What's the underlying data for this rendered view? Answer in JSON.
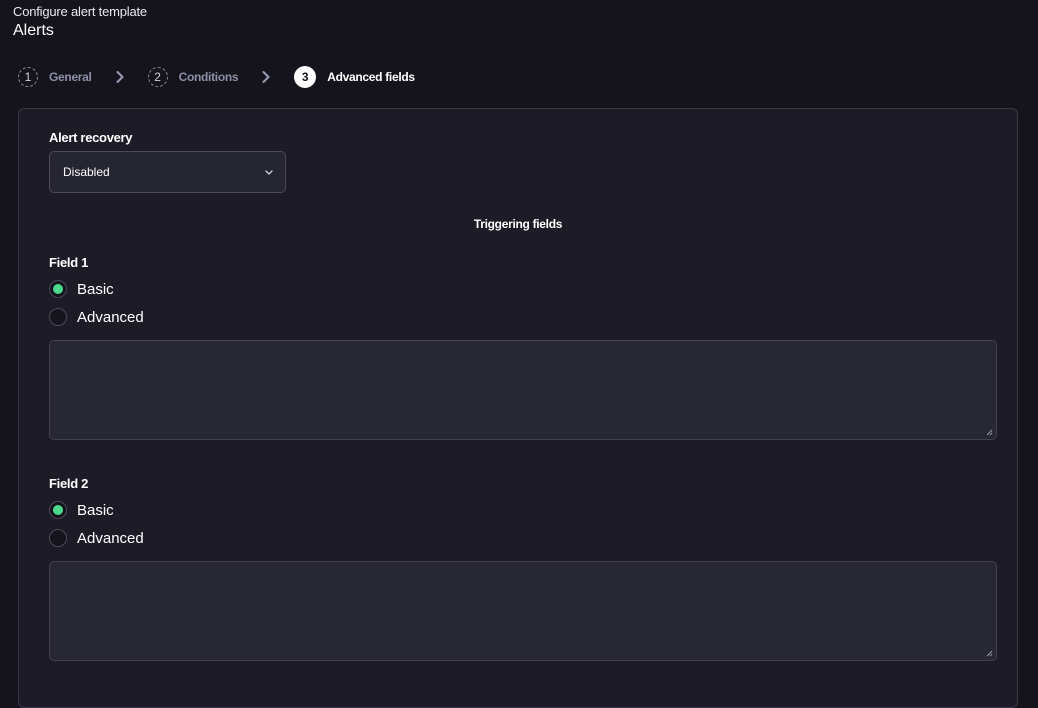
{
  "header": {
    "subtitle": "Configure alert template",
    "title": "Alerts"
  },
  "stepper": {
    "steps": [
      {
        "num": "1",
        "label": "General",
        "active": false
      },
      {
        "num": "2",
        "label": "Conditions",
        "active": false
      },
      {
        "num": "3",
        "label": "Advanced fields",
        "active": true
      }
    ]
  },
  "form": {
    "alert_recovery_label": "Alert recovery",
    "alert_recovery_value": "Disabled",
    "section_title": "Triggering fields",
    "fields": [
      {
        "label": "Field 1",
        "options": [
          "Basic",
          "Advanced"
        ],
        "selected": "Basic",
        "value": ""
      },
      {
        "label": "Field 2",
        "options": [
          "Basic",
          "Advanced"
        ],
        "selected": "Basic",
        "value": ""
      }
    ]
  },
  "colors": {
    "background": "#15141c",
    "panel": "#1d1c26",
    "radio_selected": "#4cd98c",
    "step_label_inactive": "#8d8fa8"
  }
}
